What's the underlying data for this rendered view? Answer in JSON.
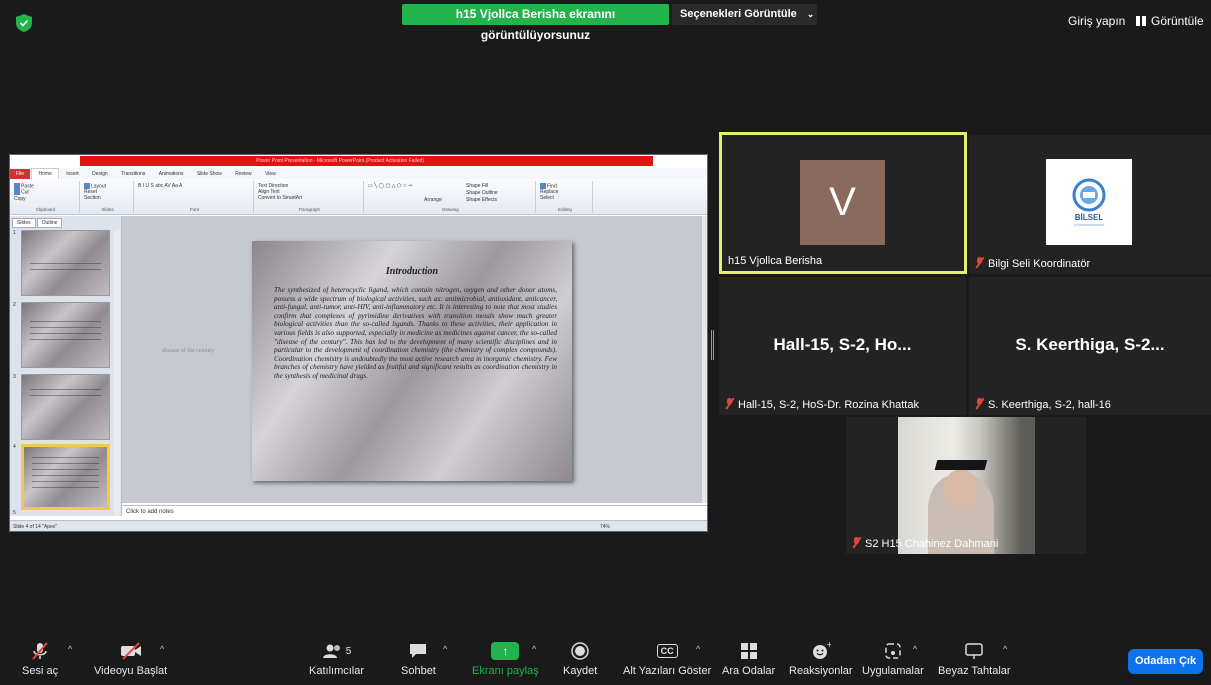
{
  "top": {
    "share_banner": "h15 Vjollca Berisha ekranını görüntülüyorsunuz",
    "view_options": "Seçenekleri Görüntüle",
    "signin": "Giriş yapın",
    "view": "Görüntüle"
  },
  "powerpoint": {
    "window_title": "Power Point Presentation - Microsoft PowerPoint (Product Activation Failed)",
    "tabs": [
      "File",
      "Home",
      "Insert",
      "Design",
      "Transitions",
      "Animations",
      "Slide Show",
      "Review",
      "View"
    ],
    "ribbon": {
      "clipboard": {
        "label": "Clipboard",
        "paste": "Paste",
        "cut": "Cut",
        "copy": "Copy",
        "format_painter": "Format Painter"
      },
      "slides": {
        "label": "Slides",
        "new_slide": "New Slide",
        "layout": "Layout",
        "reset": "Reset",
        "section": "Section"
      },
      "font": {
        "label": "Font"
      },
      "paragraph": {
        "label": "Paragraph",
        "text_direction": "Text Direction",
        "align_text": "Align Text",
        "smartart": "Convert to SmartArt"
      },
      "drawing": {
        "label": "Drawing",
        "arrange": "Arrange",
        "quick_styles": "Quick Styles",
        "shape_fill": "Shape Fill",
        "shape_outline": "Shape Outline",
        "shape_effects": "Shape Effects"
      },
      "editing": {
        "label": "Editing",
        "find": "Find",
        "replace": "Replace",
        "select": "Select"
      }
    },
    "left_tabs": [
      "Slides",
      "Outline"
    ],
    "thumb_numbers": [
      "1",
      "2",
      "3",
      "4",
      "5"
    ],
    "slide": {
      "title": "Introduction",
      "body": "The synthesized of heterocyclic ligand, which contain nitrogen, oxygen and other donor atoms, possess a wide spectrum of biological activities, such as: antimicrobial, antioxidant, anticancer, anti-fungal, anti-tumor, anti-HIV, anti-inflammatory etc. It is interesting to note that most studies confirm that complexes of pyrimidine derivatives with transition metals show much greater biological activities than the so-called ligands. Thanks to these activities, their application in various fields is also supported, especially in medicine as medicines against cancer, the so-called \"disease of the century\". This has led to the development of many scientific disciplines and in particular to the development of coordination chemistry (the chemistry of complex compounds). Coordination chemistry is undoubtedly the most active research area in inorganic chemistry. Few branches of chemistry have yielded as fruitful and significant results as coordination chemistry in the synthesis of medicinal drugs."
    },
    "ghost_text": "disease of the century",
    "notes_placeholder": "Click to add notes",
    "status": "Slide 4 of 14  \"Apex\"",
    "zoom": "74%"
  },
  "participants": [
    {
      "name": "h15 Vjollca Berisha",
      "avatar_letter": "V",
      "big_label": ""
    },
    {
      "name": "Bilgi Seli Koordinatör",
      "logo_text": "BİLSEL"
    },
    {
      "name": "Hall-15, S-2, HoS-Dr. Rozina Khattak",
      "big_label": "Hall-15, S-2, Ho..."
    },
    {
      "name": "S. Keerthiga, S-2, hall-16",
      "big_label": "S. Keerthiga, S-2..."
    },
    {
      "name": "S2 H15 Chahinez Dahmani"
    }
  ],
  "toolbar": {
    "mute": "Sesi aç",
    "video": "Videoyu Başlat",
    "participants": "Katılımcılar",
    "participant_count": "5",
    "chat": "Sohbet",
    "share": "Ekranı paylaş",
    "record": "Kaydet",
    "captions": "Alt Yazıları Göster",
    "cc": "CC",
    "breakout": "Ara Odalar",
    "reactions": "Reaksiyonlar",
    "apps": "Uygulamalar",
    "whiteboard": "Beyaz Tahtalar",
    "leave": "Odadan Çık"
  },
  "colors": {
    "share_green": "#23b34d",
    "active_speaker": "#e4f06e",
    "leave_blue": "#0e72ed",
    "muted_red": "#e0473b"
  }
}
